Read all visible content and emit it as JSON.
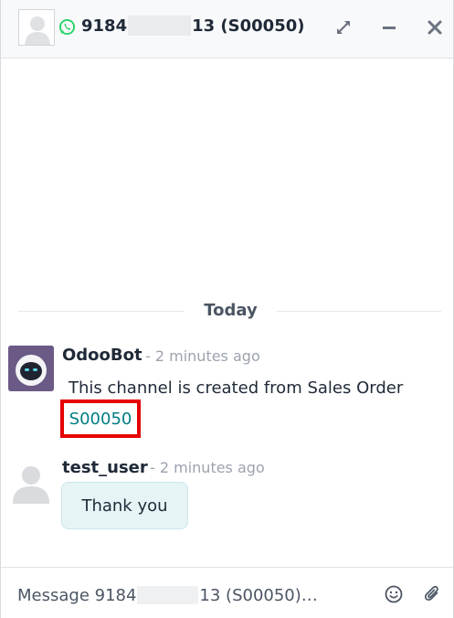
{
  "header": {
    "title_prefix": "9184",
    "title_suffix": "13 (S00050)",
    "icons": [
      "whatsapp-icon",
      "expand-icon",
      "minimize-icon",
      "close-icon"
    ]
  },
  "thread": {
    "date_separator": "Today",
    "messages": [
      {
        "author": "OdooBot",
        "time": "- 2 minutes ago",
        "body": "This channel is created from Sales Order",
        "link": "S00050"
      },
      {
        "author": "test_user",
        "time": "- 2 minutes ago",
        "body": "Thank you"
      }
    ]
  },
  "composer": {
    "placeholder_prefix": "Message 9184",
    "placeholder_suffix": "13 (S00050)…",
    "icons": [
      "emoji-icon",
      "paperclip-icon"
    ]
  },
  "colors": {
    "link": "#017e84",
    "highlight_box": "#e60000",
    "whatsapp": "#25d366",
    "bubble": "#e6f4f6"
  }
}
